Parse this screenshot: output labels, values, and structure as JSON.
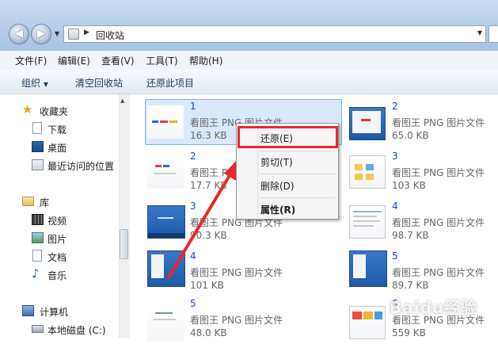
{
  "address": {
    "path": "回收站"
  },
  "menu": {
    "items": [
      "文件(F)",
      "编辑(E)",
      "查看(V)",
      "工具(T)",
      "帮助(H)"
    ]
  },
  "toolbar": {
    "organize": "组织",
    "empty_bin": "清空回收站",
    "restore_all": "还原此项目"
  },
  "nav": {
    "favorites": "收藏夹",
    "downloads": "下载",
    "desktop": "桌面",
    "recent": "最近访问的位置",
    "libraries": "库",
    "videos": "视频",
    "pictures": "图片",
    "documents": "文档",
    "music": "音乐",
    "computer": "计算机",
    "local_disk": "本地磁盘 (C:)"
  },
  "files": [
    {
      "name": "1",
      "type": "看图王 PNG 图片文件",
      "size": "16.3 KB"
    },
    {
      "name": "2",
      "type": "看图王 PNG 图片文件",
      "size": "65.0 KB"
    },
    {
      "name": "2",
      "type": "看图王 PNG 图片文件",
      "size": "17.7 KB"
    },
    {
      "name": "3",
      "type": "看图王 PNG 图片文件",
      "size": "103 KB"
    },
    {
      "name": "3",
      "type": "看图王 PNG 图片文件",
      "size": "90.3 KB"
    },
    {
      "name": "4",
      "type": "看图王 PNG 图片文件",
      "size": "98.7 KB"
    },
    {
      "name": "4",
      "type": "看图王 PNG 图片文件",
      "size": "101 KB"
    },
    {
      "name": "5",
      "type": "看图王 PNG 图片文件",
      "size": "89.7 KB"
    },
    {
      "name": "5",
      "type": "看图王 PNG 图片文件",
      "size": "48.0 KB"
    },
    {
      "name": "6",
      "type": "看图王 PNG 图片文件",
      "size": "559 KB"
    }
  ],
  "context_menu": {
    "restore": "还原(E)",
    "cut": "剪切(T)",
    "delete": "删除(D)",
    "properties": "属性(R)"
  },
  "watermark": "Baidu经验",
  "colors": {
    "highlight": "#e8282d",
    "selection": "#d9e9fb",
    "link": "#1c45b8"
  }
}
